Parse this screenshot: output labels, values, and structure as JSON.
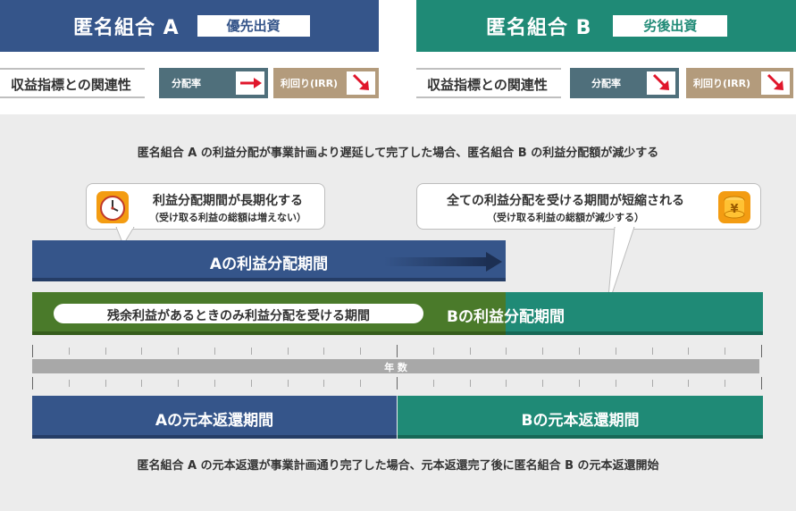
{
  "header": {
    "a": {
      "title": "匿名組合 A",
      "badge": "優先出資"
    },
    "b": {
      "title": "匿名組合 B",
      "badge": "劣後出資"
    }
  },
  "relation": {
    "label": "収益指標との関連性",
    "distribution_rate": "分配率",
    "yield": "利回り(IRR)",
    "a": {
      "distribution_arrow": "right-arrow-icon",
      "yield_arrow": "down-right-arrow-icon"
    },
    "b": {
      "distribution_arrow": "down-right-arrow-icon",
      "yield_arrow": "down-right-arrow-icon"
    }
  },
  "top_caption": "匿名組合 A の利益分配が事業計画より遅延して完了した場合、匿名組合 B の利益分配額が減少する",
  "callout_a": {
    "line1": "利益分配期間が長期化する",
    "line2": "（受け取る利益の総額は増えない）",
    "icon": "clock-icon"
  },
  "callout_b": {
    "line1": "全ての利益分配を受ける期間が短縮される",
    "line2": "（受け取る利益の総額が減少する）",
    "icon": "yen-coin-icon"
  },
  "bars": {
    "a_profit": "Aの利益分配期間",
    "residual": "残余利益があるときのみ利益分配を受ける期間",
    "b_profit": "Bの利益分配期間",
    "year_axis": "年 数",
    "a_principal": "Aの元本返還期間",
    "b_principal": "Bの元本返還期間"
  },
  "bottom_caption": "匿名組合 A の元本返還が事業計画通り完了した場合、元本返還完了後に匿名組合 B の元本返還開始",
  "colors": {
    "navy": "#35558a",
    "teal": "#1f8a76",
    "olive": "#4a7a2a",
    "tan": "#b39b7c",
    "slate": "#4f6f7b",
    "red": "#e0162b"
  }
}
